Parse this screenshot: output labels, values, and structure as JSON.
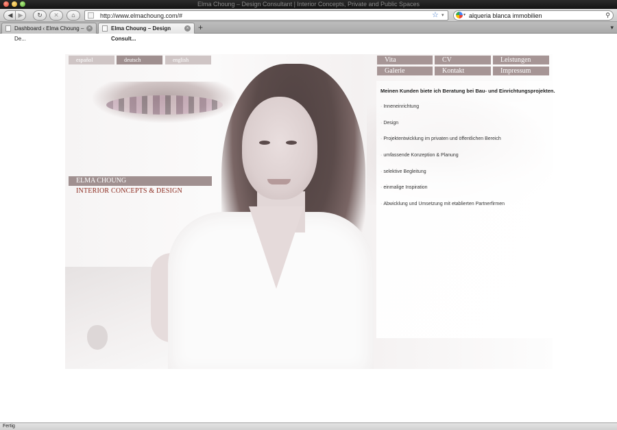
{
  "window": {
    "title": "Elma Choung – Design Consultant | Interior Concepts, Private and Public Spaces"
  },
  "toolbar": {
    "url": "http://www.elmachoung.com/#",
    "search_query": "alqueria blanca immobilien"
  },
  "tabs": [
    {
      "label": "Dashboard ‹ Elma Choung – De...",
      "active": false
    },
    {
      "label": "Elma Choung – Design Consult...",
      "active": true
    }
  ],
  "languages": [
    {
      "label": "español",
      "active": false
    },
    {
      "label": "deutsch",
      "active": true
    },
    {
      "label": "english",
      "active": false
    }
  ],
  "brand": {
    "name": "ELMA CHOUNG",
    "tagline": "INTERIOR CONCEPTS & DESIGN"
  },
  "menu": [
    "Vita",
    "CV",
    "Leistungen",
    "Galerie",
    "Kontakt",
    "Impressum"
  ],
  "content": {
    "intro": "Meinen Kunden biete ich Beratung bei Bau- und Einrichtungsprojekten.",
    "bullet": "·",
    "services": [
      "Inneneinrichtung",
      "Design",
      "Projektentwicklung im privaten und öffentlichen Bereich",
      "umfassende Konzeption & Planung",
      "selektive Begleitung",
      "einmalige Inspiration",
      "Abwicklung und Umsetzung mit etablierten Partnerfirmen"
    ]
  },
  "status": {
    "text": "Fertig"
  },
  "icons": {
    "back": "◀",
    "forward": "▶",
    "reload": "↻",
    "stop": "✕",
    "home": "⌂",
    "star": "☆",
    "dropdown": "▾",
    "search": "⚲",
    "tab_close": "×",
    "new_tab": "+"
  },
  "colors": {
    "accent_rose": "#a69595",
    "lang_active": "#9f8f8f",
    "lang_inactive": "#cfc5c5",
    "tagline": "#8b2a1e"
  }
}
